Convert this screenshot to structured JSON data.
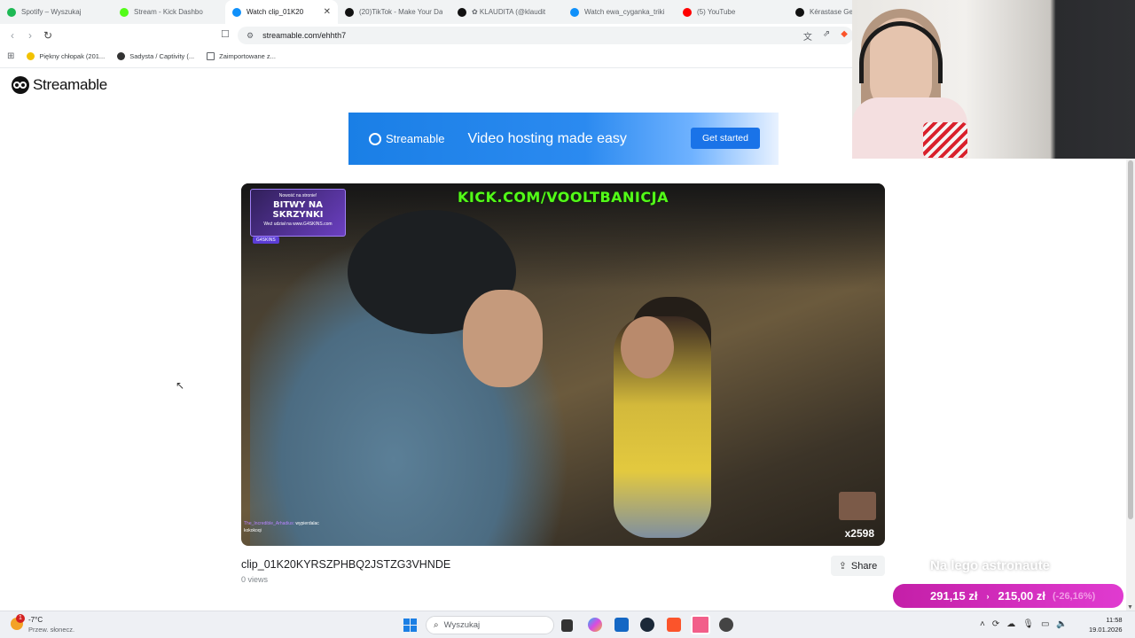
{
  "browser": {
    "tabs": [
      {
        "label": "Spotify – Wyszukaj",
        "color": "#1db954",
        "icon": "spotify-icon"
      },
      {
        "label": "Stream - Kick Dashbo",
        "color": "#53fc18",
        "icon": "kick-icon"
      },
      {
        "label": "Watch clip_01K20",
        "color": "#0f90fa",
        "icon": "streamable-icon",
        "active": true
      },
      {
        "label": "(20)TikTok - Make Your Da",
        "color": "#111111",
        "icon": "tiktok-icon"
      },
      {
        "label": "✿ KLAUDITA (@klaudit",
        "color": "#111111",
        "icon": "tiktok-icon"
      },
      {
        "label": "Watch ewa_cyganka_triki",
        "color": "#0f90fa",
        "icon": "streamable-icon"
      },
      {
        "label": "(5) YouTube",
        "color": "#ff0000",
        "icon": "youtube-icon"
      },
      {
        "label": "Kérastase Gen",
        "color": "#111111",
        "icon": "kerastase-icon"
      }
    ],
    "url": "streamable.com/ehhth7",
    "bookmarks": [
      {
        "label": "Piękny chłopak (201...",
        "color": "#f2c200"
      },
      {
        "label": "Sadysta / Captivity (...",
        "color": "#333333"
      },
      {
        "label": "Zaimportowane z...",
        "color": "#ffffff"
      }
    ]
  },
  "page": {
    "logo_text": "Streamable",
    "ad": {
      "brand": "Streamable",
      "tagline": "Video hosting made easy",
      "cta": "Get started"
    },
    "video": {
      "overlay_url": "KICK.COM/VOOLTBANICJA",
      "promo_line1": "Nowość na stronie!",
      "promo_line2": "BITWY NA SKRZYNKI",
      "promo_line3": "Weź udział na www.G4SKINS.com",
      "promo_badge": "G4SKINS",
      "chat_name": "The_Incredible_Arhadius:",
      "chat_msg1": "wyp​ierdalac",
      "chat_msg2": "kokokoqi",
      "emote_count": "x2598"
    },
    "clip_title": "clip_01K20KYRSZPHBQ2JSTZG3VHNDE",
    "views": "0 views",
    "share_label": "Share"
  },
  "stream_overlay": {
    "caption": "Na lego astronaute",
    "price_old": "291,15 zł",
    "price_new": "215,00 zł",
    "discount": "(-26,16%)"
  },
  "taskbar": {
    "weather_temp": "-7°C",
    "weather_desc": "Przew. słonecz.",
    "weather_badge": "1",
    "search_placeholder": "Wyszukaj",
    "time": "11:58",
    "date": "19.01.2026"
  }
}
